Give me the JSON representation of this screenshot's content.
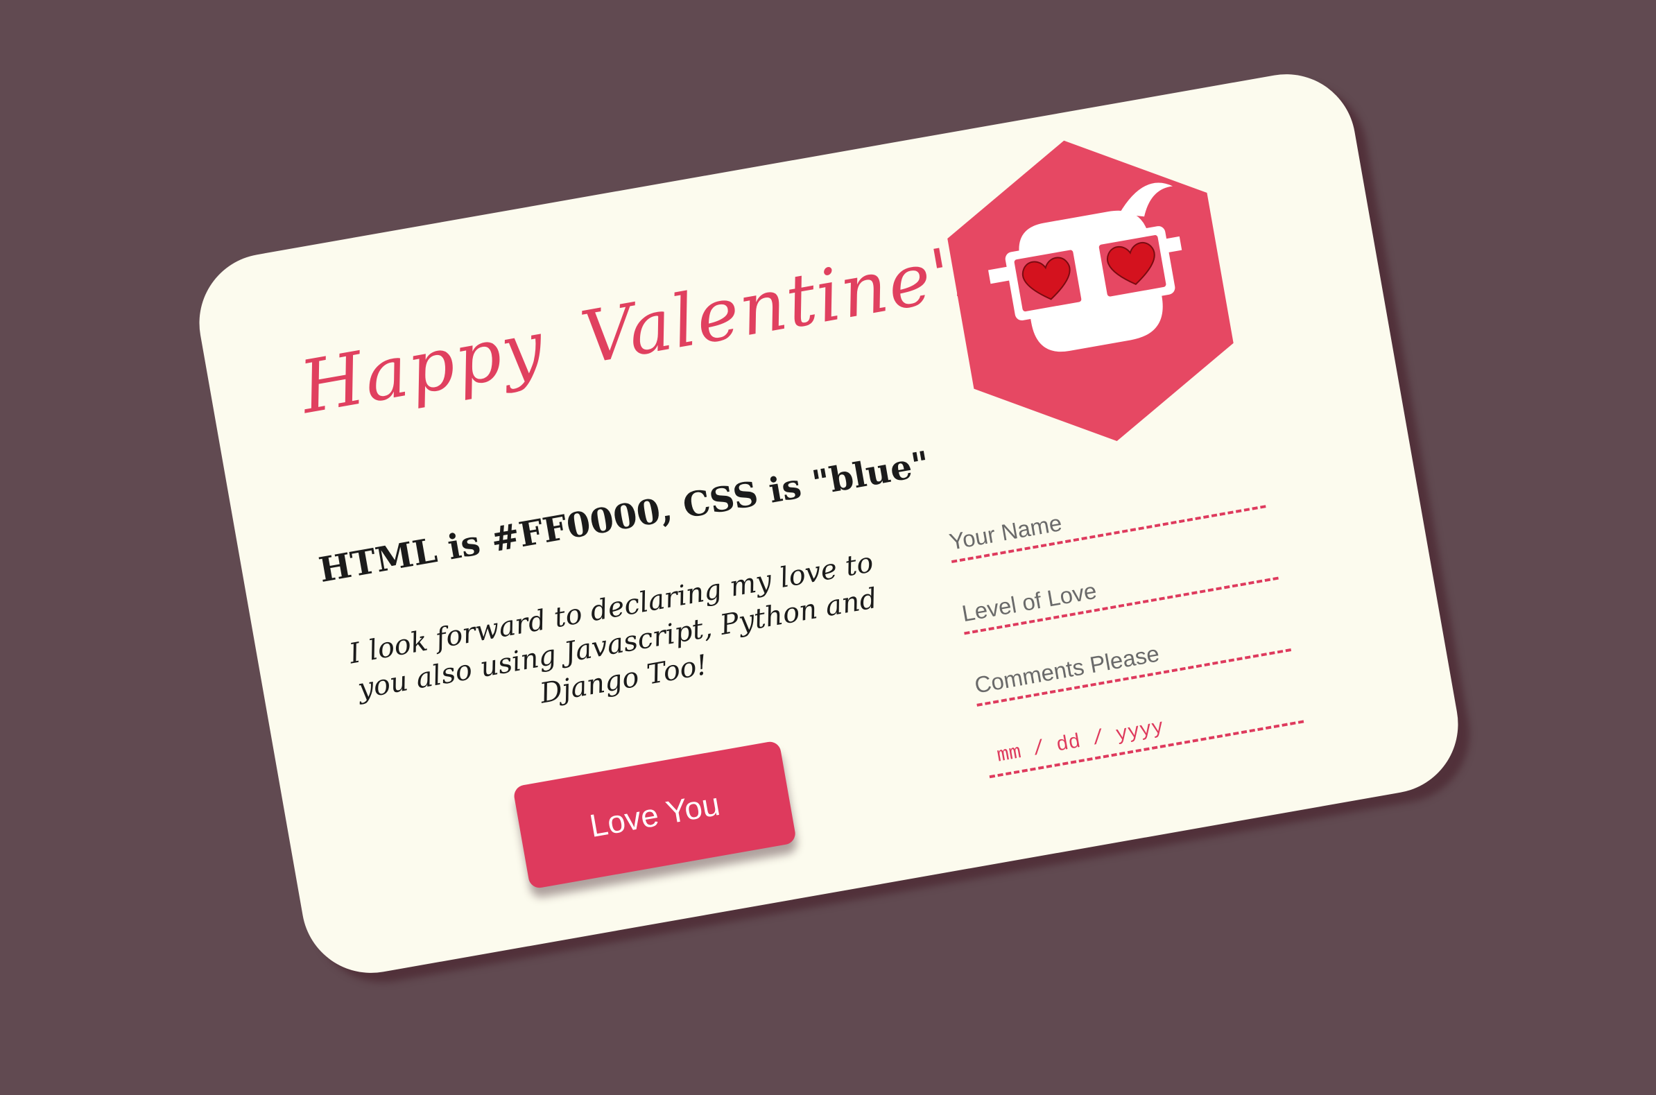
{
  "card": {
    "title": "Happy Valentine's",
    "subtitle": "HTML is #FF0000, CSS is \"blue\"",
    "message": "I look forward to declaring my love to you also using Javascript, Python and Django Too!",
    "button_label": "Love You"
  },
  "form": {
    "name_placeholder": "Your Name",
    "love_placeholder": "Level of Love",
    "comments_placeholder": "Comments Please",
    "date_placeholder": "mm / dd / yyyy"
  },
  "logo": {
    "icon": "heart-eyes-hexagon-logo"
  },
  "colors": {
    "background": "#614a51",
    "card": "#fcfbee",
    "accent": "#de3a5d",
    "text": "#1b1b1b"
  }
}
